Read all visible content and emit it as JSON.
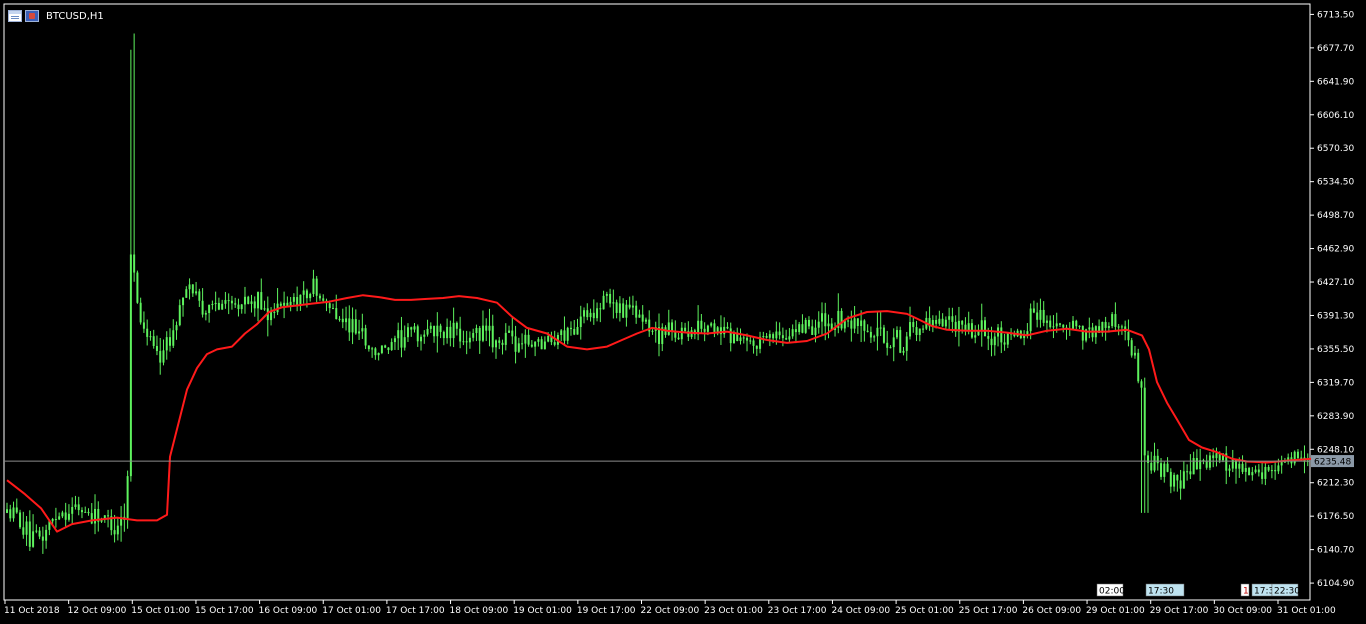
{
  "header": {
    "symbol": "BTCUSD,H1"
  },
  "colors": {
    "background": "#000000",
    "candle": "#5ef35e",
    "ma": "#ff1a1a",
    "axis": "#ffffff",
    "price_line": "#8c8c8c",
    "price_box": "#8c9aa8"
  },
  "chart_data": {
    "type": "candlestick",
    "title": "BTCUSD,H1",
    "timeframe": "H1",
    "ylim": [
      6086.8,
      6722.5
    ],
    "y_ticks": [
      "6713.50",
      "6677.70",
      "6641.90",
      "6606.10",
      "6570.30",
      "6534.50",
      "6498.70",
      "6462.90",
      "6427.10",
      "6391.30",
      "6355.50",
      "6319.70",
      "6283.90",
      "6248.10",
      "6212.30",
      "6176.50",
      "6140.70",
      "6104.90"
    ],
    "x_ticks": [
      "11 Oct 2018",
      "12 Oct 09:00",
      "15 Oct 01:00",
      "15 Oct 17:00",
      "16 Oct 09:00",
      "17 Oct 01:00",
      "17 Oct 17:00",
      "18 Oct 09:00",
      "19 Oct 01:00",
      "19 Oct 17:00",
      "22 Oct 09:00",
      "23 Oct 01:00",
      "23 Oct 17:00",
      "24 Oct 09:00",
      "25 Oct 01:00",
      "25 Oct 17:00",
      "26 Oct 09:00",
      "29 Oct 01:00",
      "29 Oct 17:00",
      "30 Oct 09:00",
      "31 Oct 01:00"
    ],
    "current_price": 6235.48,
    "current_price_label": "6235.48",
    "bars_count": 400,
    "close_path": [
      [
        0,
        6180
      ],
      [
        12,
        6175
      ],
      [
        25,
        6145
      ],
      [
        35,
        6155
      ],
      [
        50,
        6180
      ],
      [
        70,
        6185
      ],
      [
        95,
        6175
      ],
      [
        108,
        6165
      ],
      [
        120,
        6185
      ],
      [
        123,
        6330
      ],
      [
        125,
        6650
      ],
      [
        127,
        6450
      ],
      [
        132,
        6390
      ],
      [
        140,
        6375
      ],
      [
        150,
        6350
      ],
      [
        165,
        6365
      ],
      [
        172,
        6400
      ],
      [
        185,
        6420
      ],
      [
        200,
        6395
      ],
      [
        220,
        6410
      ],
      [
        240,
        6405
      ],
      [
        255,
        6400
      ],
      [
        270,
        6395
      ],
      [
        285,
        6408
      ],
      [
        298,
        6415
      ],
      [
        306,
        6420
      ],
      [
        315,
        6405
      ],
      [
        325,
        6400
      ],
      [
        340,
        6380
      ],
      [
        353,
        6375
      ],
      [
        366,
        6350
      ],
      [
        380,
        6355
      ],
      [
        395,
        6365
      ],
      [
        405,
        6375
      ],
      [
        418,
        6370
      ],
      [
        430,
        6375
      ],
      [
        445,
        6372
      ],
      [
        465,
        6370
      ],
      [
        480,
        6368
      ],
      [
        500,
        6365
      ],
      [
        520,
        6360
      ],
      [
        545,
        6365
      ],
      [
        565,
        6378
      ],
      [
        580,
        6395
      ],
      [
        597,
        6408
      ],
      [
        612,
        6400
      ],
      [
        632,
        6390
      ],
      [
        642,
        6375
      ],
      [
        660,
        6372
      ],
      [
        680,
        6375
      ],
      [
        700,
        6378
      ],
      [
        720,
        6370
      ],
      [
        740,
        6360
      ],
      [
        760,
        6365
      ],
      [
        780,
        6375
      ],
      [
        800,
        6380
      ],
      [
        820,
        6383
      ],
      [
        837,
        6380
      ],
      [
        850,
        6375
      ],
      [
        866,
        6368
      ],
      [
        880,
        6365
      ],
      [
        892,
        6362
      ],
      [
        900,
        6370
      ],
      [
        918,
        6375
      ],
      [
        934,
        6380
      ],
      [
        955,
        6375
      ],
      [
        980,
        6372
      ],
      [
        1000,
        6365
      ],
      [
        1015,
        6370
      ],
      [
        1025,
        6395
      ],
      [
        1035,
        6390
      ],
      [
        1045,
        6380
      ],
      [
        1060,
        6378
      ],
      [
        1080,
        6372
      ],
      [
        1095,
        6380
      ],
      [
        1110,
        6385
      ],
      [
        1120,
        6365
      ],
      [
        1128,
        6345
      ],
      [
        1134,
        6320
      ],
      [
        1138,
        6240
      ],
      [
        1148,
        6230
      ],
      [
        1160,
        6220
      ],
      [
        1175,
        6215
      ],
      [
        1190,
        6230
      ],
      [
        1200,
        6235
      ],
      [
        1210,
        6240
      ],
      [
        1218,
        6235
      ],
      [
        1230,
        6225
      ],
      [
        1245,
        6220
      ],
      [
        1260,
        6225
      ],
      [
        1272,
        6232
      ],
      [
        1285,
        6238
      ],
      [
        1300,
        6236
      ]
    ],
    "ma_path": [
      [
        0,
        6215
      ],
      [
        18,
        6200
      ],
      [
        34,
        6185
      ],
      [
        50,
        6160
      ],
      [
        65,
        6168
      ],
      [
        85,
        6172
      ],
      [
        110,
        6175
      ],
      [
        130,
        6172
      ],
      [
        150,
        6172
      ],
      [
        160,
        6178
      ],
      [
        163,
        6240
      ],
      [
        172,
        6278
      ],
      [
        180,
        6312
      ],
      [
        190,
        6335
      ],
      [
        200,
        6350
      ],
      [
        210,
        6355
      ],
      [
        225,
        6358
      ],
      [
        238,
        6372
      ],
      [
        250,
        6382
      ],
      [
        262,
        6395
      ],
      [
        275,
        6400
      ],
      [
        290,
        6402
      ],
      [
        305,
        6404
      ],
      [
        322,
        6406
      ],
      [
        340,
        6410
      ],
      [
        356,
        6413
      ],
      [
        372,
        6411
      ],
      [
        388,
        6408
      ],
      [
        404,
        6408
      ],
      [
        420,
        6409
      ],
      [
        436,
        6410
      ],
      [
        452,
        6412
      ],
      [
        470,
        6410
      ],
      [
        490,
        6405
      ],
      [
        505,
        6390
      ],
      [
        520,
        6378
      ],
      [
        540,
        6372
      ],
      [
        560,
        6358
      ],
      [
        580,
        6355
      ],
      [
        600,
        6358
      ],
      [
        615,
        6365
      ],
      [
        630,
        6372
      ],
      [
        645,
        6378
      ],
      [
        660,
        6375
      ],
      [
        680,
        6373
      ],
      [
        700,
        6372
      ],
      [
        720,
        6374
      ],
      [
        740,
        6370
      ],
      [
        760,
        6365
      ],
      [
        780,
        6362
      ],
      [
        800,
        6364
      ],
      [
        820,
        6372
      ],
      [
        840,
        6388
      ],
      [
        860,
        6395
      ],
      [
        880,
        6396
      ],
      [
        900,
        6393
      ],
      [
        910,
        6388
      ],
      [
        925,
        6380
      ],
      [
        940,
        6376
      ],
      [
        960,
        6375
      ],
      [
        980,
        6375
      ],
      [
        1000,
        6373
      ],
      [
        1020,
        6370
      ],
      [
        1040,
        6375
      ],
      [
        1060,
        6377
      ],
      [
        1080,
        6374
      ],
      [
        1100,
        6374
      ],
      [
        1120,
        6376
      ],
      [
        1135,
        6370
      ],
      [
        1142,
        6355
      ],
      [
        1150,
        6320
      ],
      [
        1160,
        6298
      ],
      [
        1170,
        6280
      ],
      [
        1182,
        6258
      ],
      [
        1195,
        6250
      ],
      [
        1210,
        6245
      ],
      [
        1225,
        6238
      ],
      [
        1240,
        6235
      ],
      [
        1260,
        6234
      ],
      [
        1280,
        6236
      ],
      [
        1305,
        6238
      ]
    ],
    "session_markers": [
      {
        "label": "02:00",
        "style": "dark"
      },
      {
        "label": "17:30",
        "style": "light"
      },
      {
        "label": "1",
        "style": "red"
      },
      {
        "label": "17:3",
        "style": "light"
      },
      {
        "label": "22:30",
        "style": "light"
      }
    ]
  }
}
